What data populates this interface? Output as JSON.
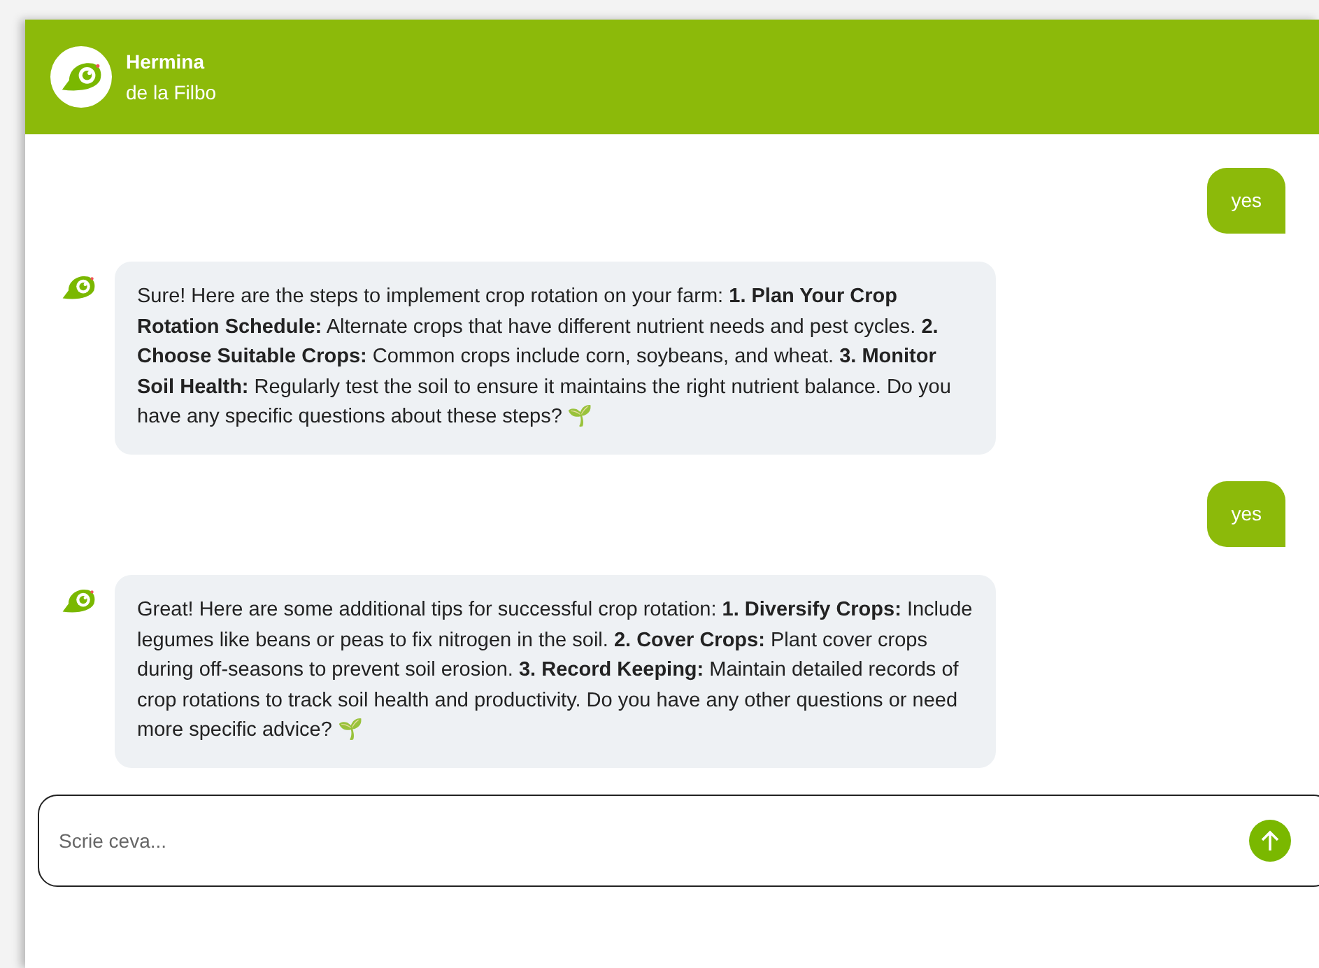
{
  "header": {
    "name": "Hermina",
    "subtitle": "de la Filbo"
  },
  "messages": [
    {
      "kind": "user",
      "text": "yes"
    },
    {
      "kind": "bot",
      "text": "Sure! Here are the steps to implement crop rotation on your farm: **1. Plan Your Crop Rotation Schedule:** Alternate crops that have different nutrient needs and pest cycles. **2. Choose Suitable Crops:** Common crops include corn, soybeans, and wheat. **3. Monitor Soil Health:** Regularly test the soil to ensure it maintains the right nutrient balance. Do you have any specific questions about these steps? 🌱"
    },
    {
      "kind": "user",
      "text": "yes"
    },
    {
      "kind": "bot",
      "text": "Great! Here are some additional tips for successful crop rotation: **1. Diversify Crops:** Include legumes like beans or peas to fix nitrogen in the soil. **2. Cover Crops:** Plant cover crops during off-seasons to prevent soil erosion. **3. Record Keeping:** Maintain detailed records of crop rotations to track soil health and productivity. Do you have any other questions or need more specific advice? 🌱"
    }
  ],
  "input": {
    "placeholder": "Scrie ceva..."
  }
}
